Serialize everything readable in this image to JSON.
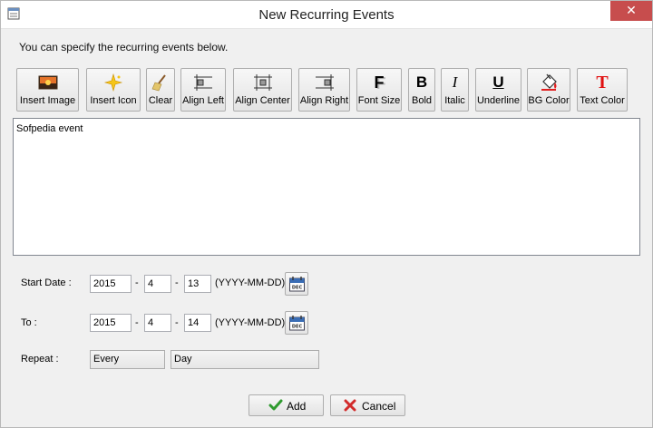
{
  "window": {
    "title": "New Recurring Events",
    "close_glyph": "✕"
  },
  "intro_text": "You can specify the recurring events below.",
  "toolbar": {
    "insert_image": "Insert Image",
    "insert_icon": "Insert Icon",
    "clear": "Clear",
    "align_left": "Align Left",
    "align_center": "Align Center",
    "align_right": "Align Right",
    "font_size": "Font Size",
    "bold": "Bold",
    "italic": "Italic",
    "underline": "Underline",
    "bg_color": "BG Color",
    "text_color": "Text Color",
    "bold_glyph": "B",
    "italic_glyph": "I",
    "underline_glyph": "U",
    "text_color_glyph": "T",
    "font_size_glyph": "F"
  },
  "editor": {
    "content": "Sofpedia event"
  },
  "start_date": {
    "label": "Start Date :",
    "year": "2015",
    "month": "4",
    "day": "13",
    "format": "(YYYY-MM-DD)"
  },
  "to_date": {
    "label": "To :",
    "year": "2015",
    "month": "4",
    "day": "14",
    "format": "(YYYY-MM-DD)"
  },
  "date_separator": "-",
  "calendar_text": "DEC",
  "repeat": {
    "label": "Repeat :",
    "frequency": "Every",
    "unit": "Day"
  },
  "buttons": {
    "add": "Add",
    "cancel": "Cancel"
  },
  "colors": {
    "close_red": "#c74d4d",
    "add_check": "#2e9a2e",
    "cancel_x": "#d22b2b",
    "text_color_t": "#e01010"
  }
}
